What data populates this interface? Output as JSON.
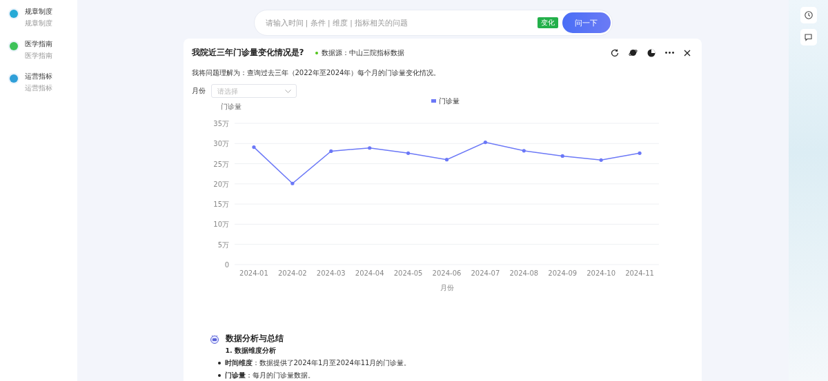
{
  "sidebar": {
    "items": [
      {
        "title": "规章制度",
        "subtitle": "规章制度",
        "color": "#25a9d6"
      },
      {
        "title": "医学指南",
        "subtitle": "医学指南",
        "color": "#3cc25a"
      },
      {
        "title": "运营指标",
        "subtitle": "运营指标",
        "color": "#2f9fd8"
      }
    ]
  },
  "search": {
    "placeholder": "请输入时间 | 条件 | 维度 | 指标相关的问题",
    "tag": "变化",
    "button": "问一下"
  },
  "card": {
    "title": "我院近三年门诊量变化情况是?",
    "source": "数据源：中山三院指标数据",
    "understanding": "我将问题理解为：查询过去三年（2022年至2024年）每个月的门诊量变化情况。",
    "filter": {
      "label": "月份",
      "placeholder": "请选择"
    },
    "chart_data": {
      "type": "line",
      "xlabel": "月份",
      "ylabel": "门诊量",
      "categories": [
        "2024-01",
        "2024-02",
        "2024-03",
        "2024-04",
        "2024-05",
        "2024-06",
        "2024-07",
        "2024-08",
        "2024-09",
        "2024-10",
        "2024-11"
      ],
      "series": [
        {
          "name": "门诊量",
          "color": "#6b78f7",
          "values": [
            29.1,
            20.1,
            28.1,
            28.9,
            27.6,
            26.0,
            30.3,
            28.2,
            26.9,
            25.9,
            27.6
          ]
        }
      ],
      "ylim": [
        0,
        35
      ],
      "grid": true,
      "yticks": [
        {
          "value": 0,
          "label": "0"
        },
        {
          "value": 5,
          "label": "5万"
        },
        {
          "value": 10,
          "label": "10万"
        },
        {
          "value": 15,
          "label": "15万"
        },
        {
          "value": 20,
          "label": "20万"
        },
        {
          "value": 25,
          "label": "25万"
        },
        {
          "value": 30,
          "label": "30万"
        },
        {
          "value": 35,
          "label": "35万"
        }
      ]
    },
    "analysis": {
      "title": "数据分析与总结",
      "subtitle": "1. 数据维度分析",
      "bullets": [
        "**时间维度**：数据提供了2024年1月至2024年11月的门诊量。",
        "**门诊量**：每月的门诊量数据。"
      ]
    }
  }
}
